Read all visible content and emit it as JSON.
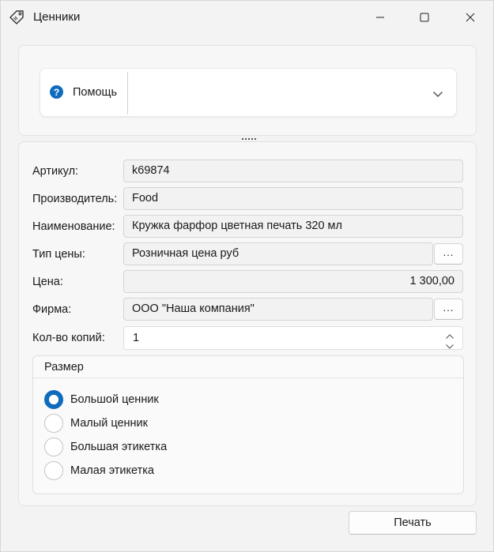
{
  "window": {
    "title": "Ценники"
  },
  "help": {
    "label": "Помощь"
  },
  "form": {
    "article_label": "Артикул:",
    "article_value": "k69874",
    "manufacturer_label": "Производитель:",
    "manufacturer_value": "Food",
    "name_label": "Наименование:",
    "name_value": "Кружка фарфор цветная печать 320 мл",
    "price_type_label": "Тип цены:",
    "price_type_value": "Розничная цена руб",
    "price_label": "Цена:",
    "price_value": "1 300,00",
    "firm_label": "Фирма:",
    "firm_value": "ООО \"Наша компания\"",
    "copies_label": "Кол-во копий:",
    "copies_value": "1",
    "browse_label": "..."
  },
  "size_group": {
    "title": "Размер",
    "options": [
      {
        "label": "Большой ценник",
        "checked": true
      },
      {
        "label": "Малый ценник",
        "checked": false
      },
      {
        "label": "Большая этикетка",
        "checked": false
      },
      {
        "label": "Малая этикетка",
        "checked": false
      }
    ]
  },
  "actions": {
    "print_label": "Печать"
  },
  "colors": {
    "accent": "#0f6cbd",
    "background": "#f3f3f3"
  },
  "icons": {
    "app": "price-tag-icon",
    "help": "question-circle-icon",
    "expand": "chevron-down-icon",
    "minimize": "minimize-icon",
    "maximize": "maximize-icon",
    "close": "close-icon"
  }
}
